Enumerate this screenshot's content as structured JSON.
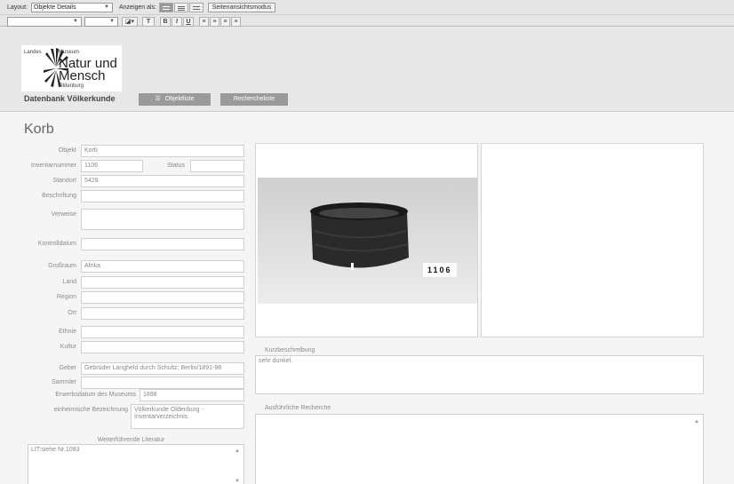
{
  "toolbar": {
    "layout_label": "Layout:",
    "layout_value": "Objekte Details",
    "view_label": "Anzeigen als:",
    "page_view_button": "Seitenansichtsmodus",
    "format_text_button": "T",
    "bold": "B",
    "italic": "I",
    "underline": "U"
  },
  "header": {
    "logo_top_left": "Landes",
    "logo_top_right": "Museum",
    "logo_line1": "Natur und",
    "logo_line2": "Mensch",
    "logo_city": "Oldenburg",
    "db_title": "Datenbank Völkerkunde",
    "nav_objektliste": "Objektliste",
    "nav_recherche": "Recherche­liste"
  },
  "record": {
    "title": "Korb",
    "objekt_label": "Objekt",
    "objekt": "Korb",
    "inventar_label": "Inventarnummer",
    "inventar": "1106",
    "status_label": "Status",
    "status": "",
    "standort_label": "Standort",
    "standort": "5428",
    "beschriftung_label": "Beschriftung",
    "beschriftung": "",
    "verweise_label": "Verweise",
    "verweise": "",
    "kontrolldatum_label": "Kontrolldatum",
    "kontrolldatum": "",
    "grossraum_label": "Großraum",
    "grossraum": "Afrika",
    "land_label": "Land",
    "land": "",
    "region_label": "Region",
    "region": "",
    "ort_label": "Ort",
    "ort": "",
    "ethnie_label": "Ethnie",
    "ethnie": "",
    "kultur_label": "Kultur",
    "kultur": "",
    "geber_label": "Geber",
    "geber": "Gebrüder Langheld durch Schultz; Berlin/1891-98",
    "sammler_label": "Sammler",
    "sammler": "",
    "erwerbsdatum_label": "Erwerbsdatum des Museums",
    "erwerbsdatum": "1898",
    "einheimisch_label": "einheimische Bezeichnung",
    "einheimisch": "Völkerkunde Oldenburg - Inventarverzeichnis",
    "literatur_label": "Weiterführende Literatur",
    "literatur": "LIT:siehe Nr.1083",
    "kurz_label": "Kurzbeschreibung",
    "kurz": "sehr dunkel.",
    "recherche_label": "Ausführliche Recherche",
    "recherche": "",
    "photo_tag": "1106"
  },
  "colors": {
    "nav_button": "#9a9a9a",
    "background": "#f5f5f5"
  }
}
